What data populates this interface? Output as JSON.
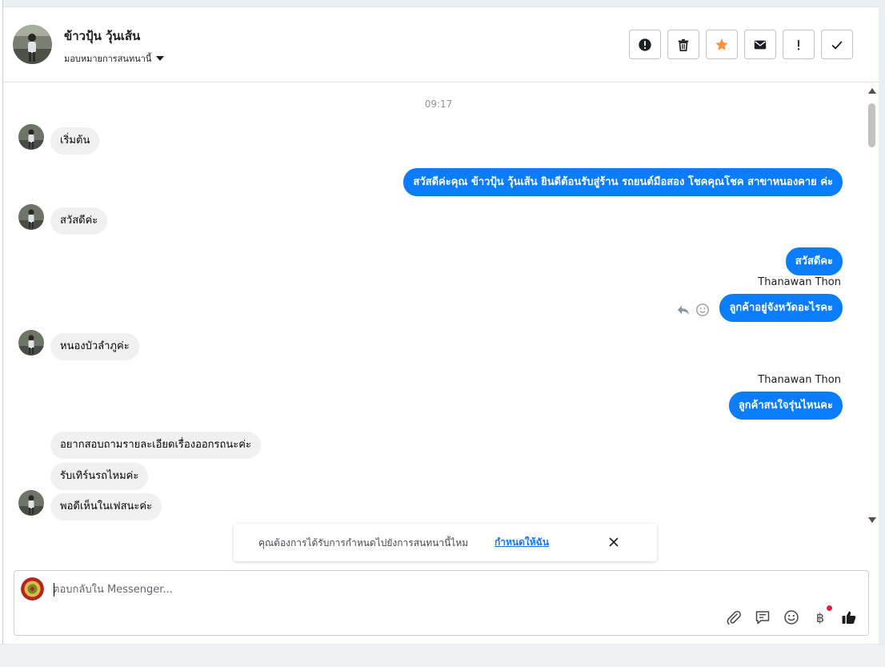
{
  "header": {
    "contact_name": "ข้าวปุ้น วุ้นเส้น",
    "assign_label": "มอบหมายการสนทนานี้",
    "toolbar": [
      {
        "name": "report-spam-button",
        "icon": "alert-circle-icon"
      },
      {
        "name": "delete-button",
        "icon": "trash-icon"
      },
      {
        "name": "star-button",
        "icon": "star-icon"
      },
      {
        "name": "mark-unread-button",
        "icon": "envelope-icon"
      },
      {
        "name": "follow-up-button",
        "icon": "exclamation-icon"
      },
      {
        "name": "mark-done-button",
        "icon": "check-icon"
      }
    ],
    "star_color": "#f7923b"
  },
  "thread": {
    "timestamp": "09:17",
    "messages": [
      {
        "dir": "in",
        "text": "เริ่มต้น"
      },
      {
        "dir": "out",
        "text": "สวัสดีค่ะคุณ ข้าวปุ้น วุ้นเส้น ยินดีต้อนรับสู่ร้าน รถยนต์มือสอง โชคคุณโชค สาขาหนองคาย ค่ะ"
      },
      {
        "dir": "in",
        "text": "สวัสดีค่ะ"
      },
      {
        "dir": "out",
        "text": "สวัสดีคะ"
      },
      {
        "dir": "sender",
        "text": "Thanawan Thon"
      },
      {
        "dir": "out",
        "text": "ลูกค้าอยู่จังหวัดอะไรคะ"
      },
      {
        "dir": "in",
        "text": "หนองบัวลำภูค่ะ"
      },
      {
        "dir": "sender",
        "text": "Thanawan Thon"
      },
      {
        "dir": "out",
        "text": "ลูกค้าสนใจรุ่นไหนคะ"
      },
      {
        "dir": "in",
        "text": "อยากสอบถามรายละเอียดเรื่องออกรถนะค่ะ"
      },
      {
        "dir": "in",
        "text": "รับเทิร์นรถไหมค่ะ"
      },
      {
        "dir": "in",
        "text": "พอดีเห็นในเฟสนะค่ะ"
      }
    ],
    "outgoing_color": "#0a7cff",
    "incoming_color": "#f0f0f0"
  },
  "notice": {
    "text": "คุณต้องการได้รับการกำหนดไปยังการสนทนานี้ไหม",
    "link": "กำหนดให้ฉัน"
  },
  "composer": {
    "placeholder": "ตอบกลับใน Messenger...",
    "tools": [
      "paperclip-icon",
      "saved-reply-icon",
      "emoji-icon",
      "baht-icon",
      "like-icon"
    ],
    "baht_symbol": "฿"
  }
}
